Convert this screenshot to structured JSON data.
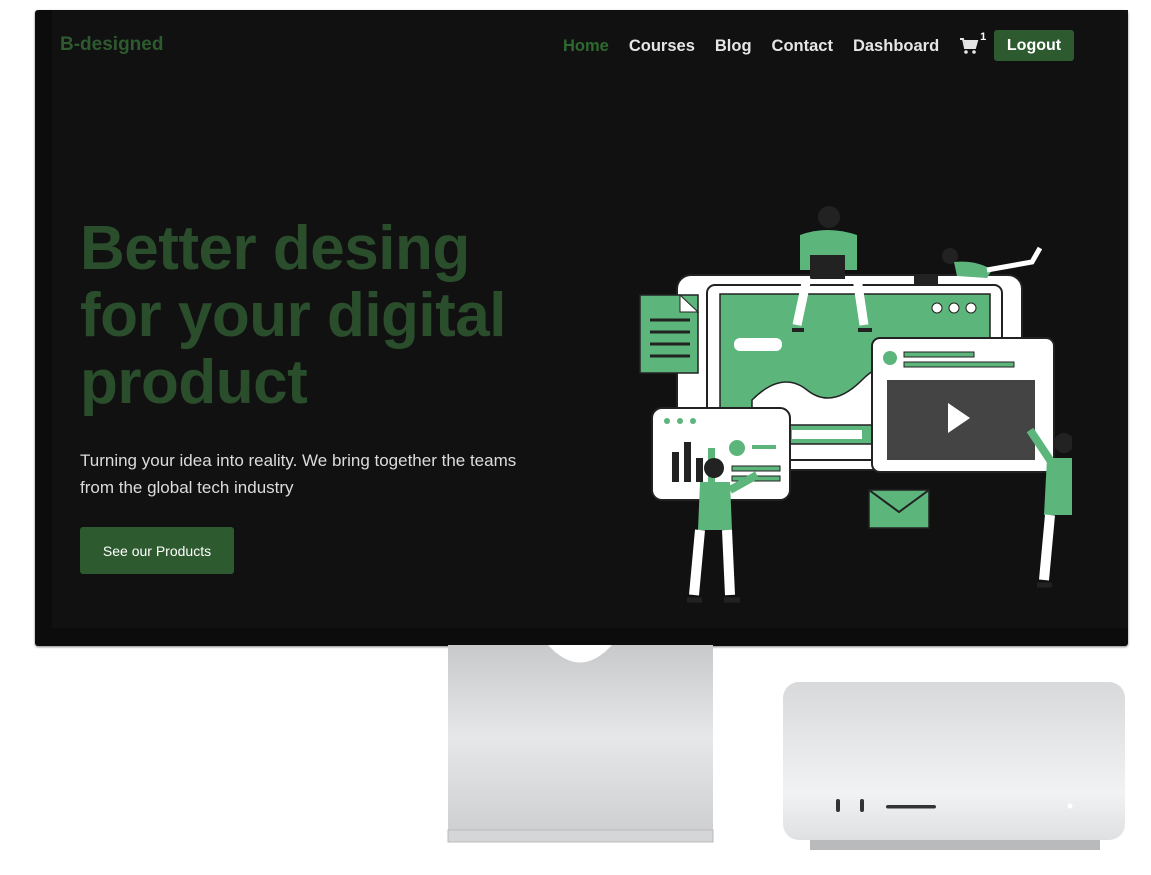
{
  "nav": {
    "logo": "B-designed",
    "links": [
      "Home",
      "Courses",
      "Blog",
      "Contact",
      "Dashboard"
    ],
    "active": "Home",
    "cart_count": "1",
    "logout_label": "Logout"
  },
  "hero": {
    "title_line1": "Better desing",
    "title_line2": "for your digital",
    "title_line3": "product",
    "subtitle": "Turning your idea into reality. We bring together the teams from the global tech industry",
    "cta_label": "See our Products"
  },
  "colors": {
    "brand": "#2d5a2f",
    "accent_green": "#5cb57a",
    "screen_bg": "#111111"
  },
  "icons": {
    "cart": "cart-icon"
  }
}
